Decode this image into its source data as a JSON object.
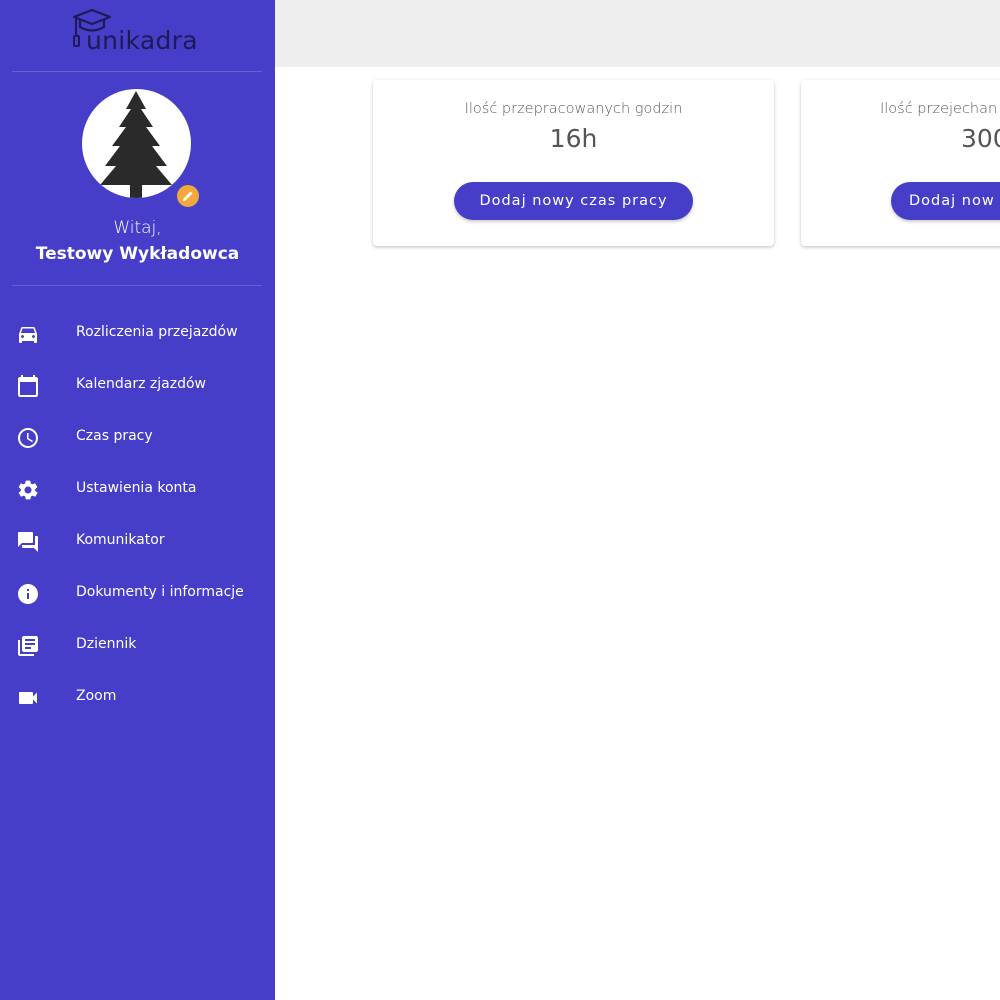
{
  "brand": {
    "name": "unikadra",
    "icon": "graduation-cap-icon"
  },
  "profile": {
    "greeting": "Witaj,",
    "name": "Testowy Wykładowca",
    "edit_icon": "pencil-icon"
  },
  "nav": {
    "items": [
      {
        "label": "Rozliczenia przejazdów",
        "icon": "car-icon"
      },
      {
        "label": "Kalendarz zjazdów",
        "icon": "calendar-icon"
      },
      {
        "label": "Czas pracy",
        "icon": "clock-icon"
      },
      {
        "label": "Ustawienia konta",
        "icon": "gear-icon"
      },
      {
        "label": "Komunikator",
        "icon": "chat-icon"
      },
      {
        "label": "Dokumenty i informacje",
        "icon": "info-icon"
      },
      {
        "label": "Dziennik",
        "icon": "library-books-icon"
      },
      {
        "label": "Zoom",
        "icon": "videocam-icon"
      }
    ]
  },
  "cards": [
    {
      "title": "Ilość przepracowanych godzin",
      "value": "16h",
      "button": "Dodaj nowy czas pracy"
    },
    {
      "title": "Ilość przejechan",
      "value": "300",
      "button": "Dodaj now"
    }
  ],
  "colors": {
    "sidebar": "#463ec9",
    "accent": "#463ec9",
    "edit_badge": "#f2a93b",
    "topbar": "#eeeeee"
  }
}
